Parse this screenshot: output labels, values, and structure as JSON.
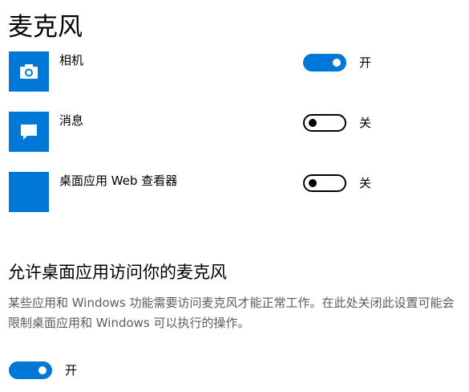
{
  "page": {
    "title": "麦克风"
  },
  "apps": [
    {
      "name": "相机",
      "icon": "camera-icon",
      "state_label": "开",
      "enabled": true
    },
    {
      "name": "消息",
      "icon": "message-icon",
      "state_label": "关",
      "enabled": false
    },
    {
      "name": "桌面应用 Web 查看器",
      "icon": "app-tile-icon",
      "state_label": "关",
      "enabled": false
    }
  ],
  "desktop_section": {
    "heading": "允许桌面应用访问你的麦克风",
    "description": "某些应用和 Windows 功能需要访问麦克风才能正常工作。在此处关闭此设置可能会限制桌面应用和 Windows 可以执行的操作。",
    "toggle_label": "开",
    "enabled": true
  },
  "colors": {
    "accent": "#0078d7",
    "secondary_text": "#5d5d5d"
  }
}
